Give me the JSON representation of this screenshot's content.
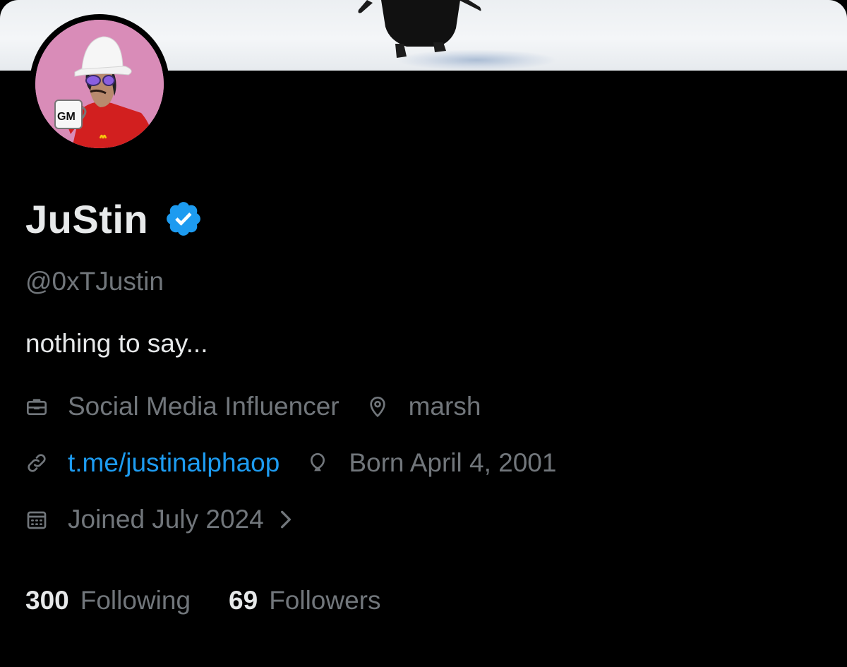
{
  "profile": {
    "display_name": "JuStin",
    "handle": "@0xTJustin",
    "bio": "nothing to say...",
    "verified_color": "#1d9bf0",
    "avatar_mug_text": "GM"
  },
  "meta": {
    "profession": {
      "icon": "briefcase-icon",
      "text": "Social Media Influencer"
    },
    "location": {
      "icon": "location-pin-icon",
      "text": "marsh"
    },
    "website": {
      "icon": "link-icon",
      "text": "t.me/justinalphaop"
    },
    "birthday": {
      "icon": "balloon-icon",
      "text": "Born April 4, 2001"
    },
    "joined": {
      "icon": "calendar-icon",
      "text": "Joined July 2024"
    }
  },
  "stats": {
    "following_count": "300",
    "following_label": "Following",
    "followers_count": "69",
    "followers_label": "Followers"
  },
  "colors": {
    "background": "#000000",
    "text_primary": "#e7e9ea",
    "text_secondary": "#71767b",
    "accent": "#1d9bf0"
  }
}
